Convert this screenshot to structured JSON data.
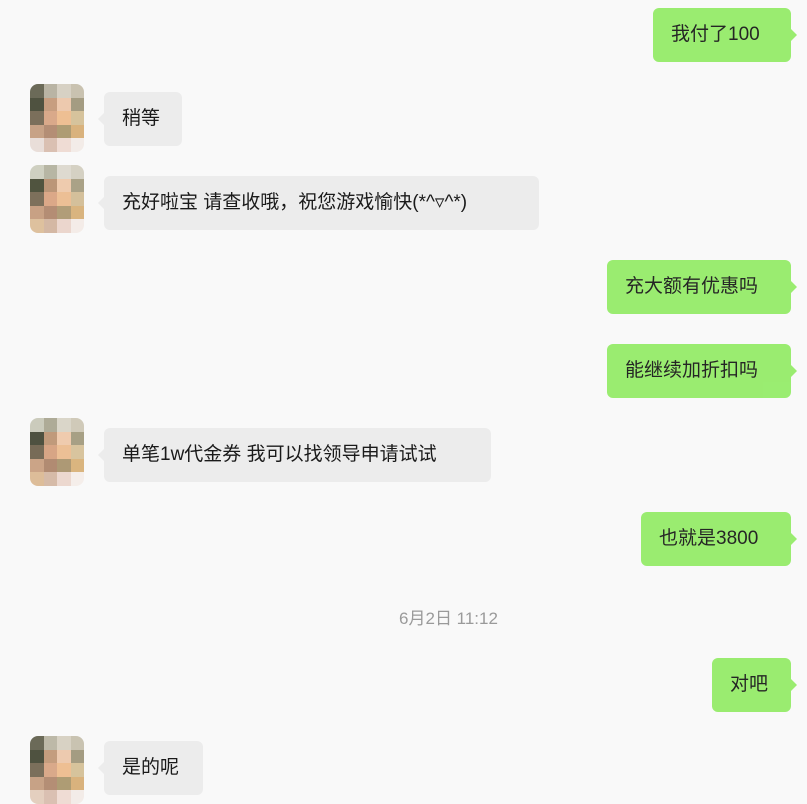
{
  "conversation": {
    "messages": [
      {
        "side": "right",
        "text": "我付了100"
      },
      {
        "side": "left",
        "text": "稍等"
      },
      {
        "side": "left",
        "text": "充好啦宝 请查收哦，祝您游戏愉快(*^▿^*)"
      },
      {
        "side": "right",
        "text": "充大额有优惠吗"
      },
      {
        "side": "right",
        "text": "能继续加折扣吗"
      },
      {
        "side": "left",
        "text": "单笔1w代金券 我可以找领导申请试试"
      },
      {
        "side": "right",
        "text": "也就是3800"
      },
      {
        "side": "right",
        "text": "对吧"
      },
      {
        "side": "left",
        "text": "是的呢"
      }
    ],
    "timestamp": "6月2日 11:12"
  },
  "colors": {
    "outgoing_bubble": "#95ec69",
    "incoming_bubble": "#ececec",
    "background": "#f9f9f9",
    "timestamp_text": "#9a9a9a"
  }
}
